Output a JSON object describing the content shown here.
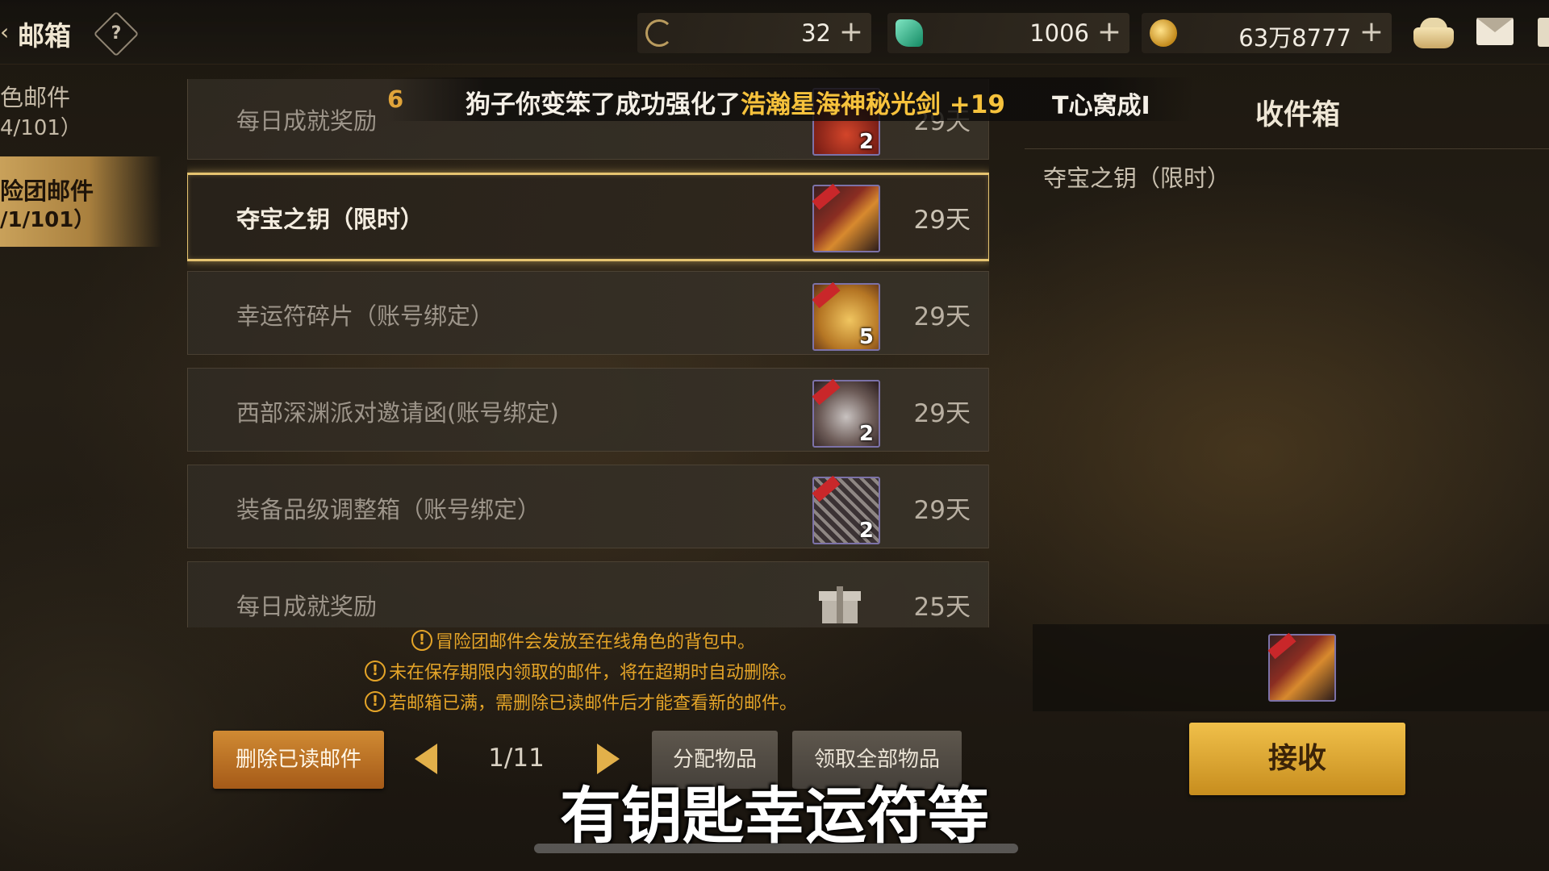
{
  "header": {
    "back_glyph": "‹",
    "title": "邮箱",
    "help_glyph": "?",
    "currencies": [
      {
        "icon": "crescent-coin-icon",
        "value": "32",
        "plus": "+"
      },
      {
        "icon": "green-gem-icon",
        "value": "1006",
        "plus": "+"
      },
      {
        "icon": "gold-coin-icon",
        "value": "63万8777",
        "plus": "+"
      }
    ],
    "right_icons": [
      "bag-icon",
      "mail-icon"
    ]
  },
  "tabs": [
    {
      "line1": "色邮件",
      "line2": "4/101）",
      "active": false
    },
    {
      "line1": "险团邮件",
      "line2": "/1/101）",
      "active": true
    }
  ],
  "banner": {
    "left_fragment": "6",
    "prefix": "狗子你变笨了成功强化了",
    "highlight": "浩瀚星海神秘光剑 +19",
    "right_fragment": "T心窝成I"
  },
  "mails": [
    {
      "title": "每日成就奖励",
      "days": "29天",
      "icon": "red-bag-icon",
      "count": "2",
      "selected": false
    },
    {
      "title": "夺宝之钥（限时）",
      "days": "29天",
      "icon": "golden-key-icon",
      "count": "",
      "selected": true
    },
    {
      "title": "幸运符碎片（账号绑定）",
      "days": "29天",
      "icon": "lucky-charm-icon",
      "count": "5",
      "selected": false
    },
    {
      "title": "西部深渊派对邀请函(账号绑定)",
      "days": "29天",
      "icon": "invitation-icon",
      "count": "2",
      "selected": false
    },
    {
      "title": "装备品级调整箱（账号绑定）",
      "days": "29天",
      "icon": "equipment-box-icon",
      "count": "2",
      "selected": false
    },
    {
      "title": "每日成就奖励",
      "days": "25天",
      "icon": "gift-icon",
      "count": "",
      "selected": false
    }
  ],
  "notes": [
    "冒险团邮件会发放至在线角色的背包中。",
    "未在保存期限内领取的邮件，将在超期时自动删除。",
    "若邮箱已满，需删除已读邮件后才能查看新的邮件。"
  ],
  "note_glyph": "!",
  "pagination": {
    "current": "1/11"
  },
  "buttons": {
    "delete_read": "删除已读邮件",
    "distribute": "分配物品",
    "claim_all": "领取全部物品",
    "receive": "接收"
  },
  "detail": {
    "inbox_title": "收件箱",
    "mail_title": "夺宝之钥（限时）",
    "attachment_icon": "golden-key-icon"
  },
  "subtitle": "有钥匙幸运符等",
  "colors": {
    "accent_gold": "#e6c470",
    "notice_orange": "#e4a428",
    "receive_button": "#f0c04a",
    "delete_button": "#d08a33"
  }
}
